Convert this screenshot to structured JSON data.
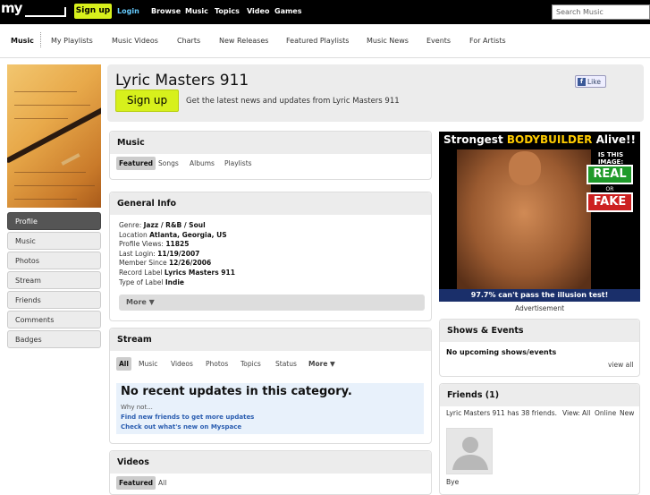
{
  "topbar": {
    "logo_text": "my",
    "signup_label": "Sign up",
    "login_label": "Login",
    "nav": [
      "Browse",
      "Music",
      "Topics",
      "Video",
      "Games"
    ],
    "search_placeholder": "Search Music"
  },
  "subnav": {
    "items": [
      "Music",
      "My Playlists",
      "Music Videos",
      "Charts",
      "New Releases",
      "Featured Playlists",
      "Music News",
      "Events",
      "For Artists"
    ]
  },
  "sidebar": {
    "items": [
      "Profile",
      "Music",
      "Photos",
      "Stream",
      "Friends",
      "Comments",
      "Badges"
    ],
    "active": "Profile"
  },
  "profile": {
    "name": "Lyric Masters 911",
    "signup_label": "Sign up",
    "tagline": "Get the latest news and updates from Lyric Masters 911",
    "like_label": "Like"
  },
  "music_panel": {
    "title": "Music",
    "tabs": [
      "Featured",
      "Songs",
      "Albums",
      "Playlists"
    ]
  },
  "general_info": {
    "title": "General Info",
    "rows": [
      {
        "label": "Genre:",
        "value": "Jazz / R&B / Soul"
      },
      {
        "label": "Location",
        "value": "Atlanta, Georgia, US"
      },
      {
        "label": "Profile Views:",
        "value": "11825"
      },
      {
        "label": "Last Login:",
        "value": "11/19/2007"
      },
      {
        "label": "Member Since",
        "value": "12/26/2006"
      },
      {
        "label": "Record Label",
        "value": "Lyrics Masters 911"
      },
      {
        "label": "Type of Label",
        "value": "Indie"
      }
    ],
    "more_label": "More ▼"
  },
  "stream": {
    "title": "Stream",
    "tabs": [
      "All",
      "Music",
      "Videos",
      "Photos",
      "Topics",
      "Status",
      "More ▼"
    ],
    "empty_heading": "No recent updates in this category.",
    "why_not": "Why not...",
    "link1": "Find new friends to get more updates",
    "link2": "Check out what's new on Myspace"
  },
  "videos": {
    "title": "Videos",
    "tabs": [
      "Featured",
      "All"
    ]
  },
  "ad": {
    "title_prefix": "Strongest ",
    "title_highlight": "BODYBUILDER",
    "title_suffix": " Alive!!",
    "question": "IS THIS IMAGE:",
    "real": "REAL",
    "or": "OR",
    "fake": "FAKE",
    "footer": "97.7% can't pass the illusion test! officialiqquiz.com",
    "label": "Advertisement"
  },
  "shows": {
    "title": "Shows & Events",
    "empty": "No upcoming shows/events",
    "view_all": "view all"
  },
  "friends": {
    "title": "Friends (1)",
    "summary": "Lyric Masters 911 has 38 friends.",
    "view_label": "View:",
    "view_all": "All",
    "view_online": "Online",
    "view_new": "New",
    "friend_name": "Bye"
  },
  "colors": {
    "topbar": "#000000",
    "signup_accent": "#d7f01c",
    "link": "#2a5db0",
    "panel_header": "#ececec"
  }
}
